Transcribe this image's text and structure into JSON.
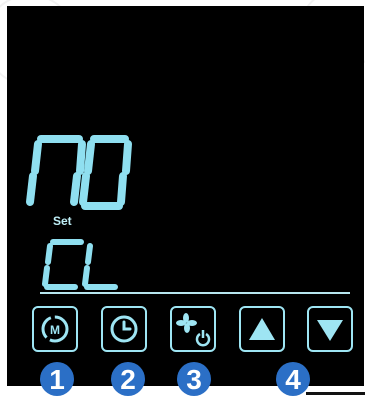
{
  "display": {
    "main_text": "NO",
    "set_label": "Set",
    "sub_text": "CL"
  },
  "buttons": [
    {
      "icon": "mode-cycle-icon",
      "glyph": "M",
      "callout": "1"
    },
    {
      "icon": "clock-icon",
      "callout": "2"
    },
    {
      "icon": "fan-power-icon",
      "callout": "3"
    },
    {
      "icon": "up-arrow-icon",
      "callout": "4"
    },
    {
      "icon": "down-arrow-icon",
      "callout": ""
    }
  ],
  "colors": {
    "lcd_segment": "#8fdff0",
    "panel_bg": "#000000",
    "callout_badge": "#2b6fc6"
  }
}
